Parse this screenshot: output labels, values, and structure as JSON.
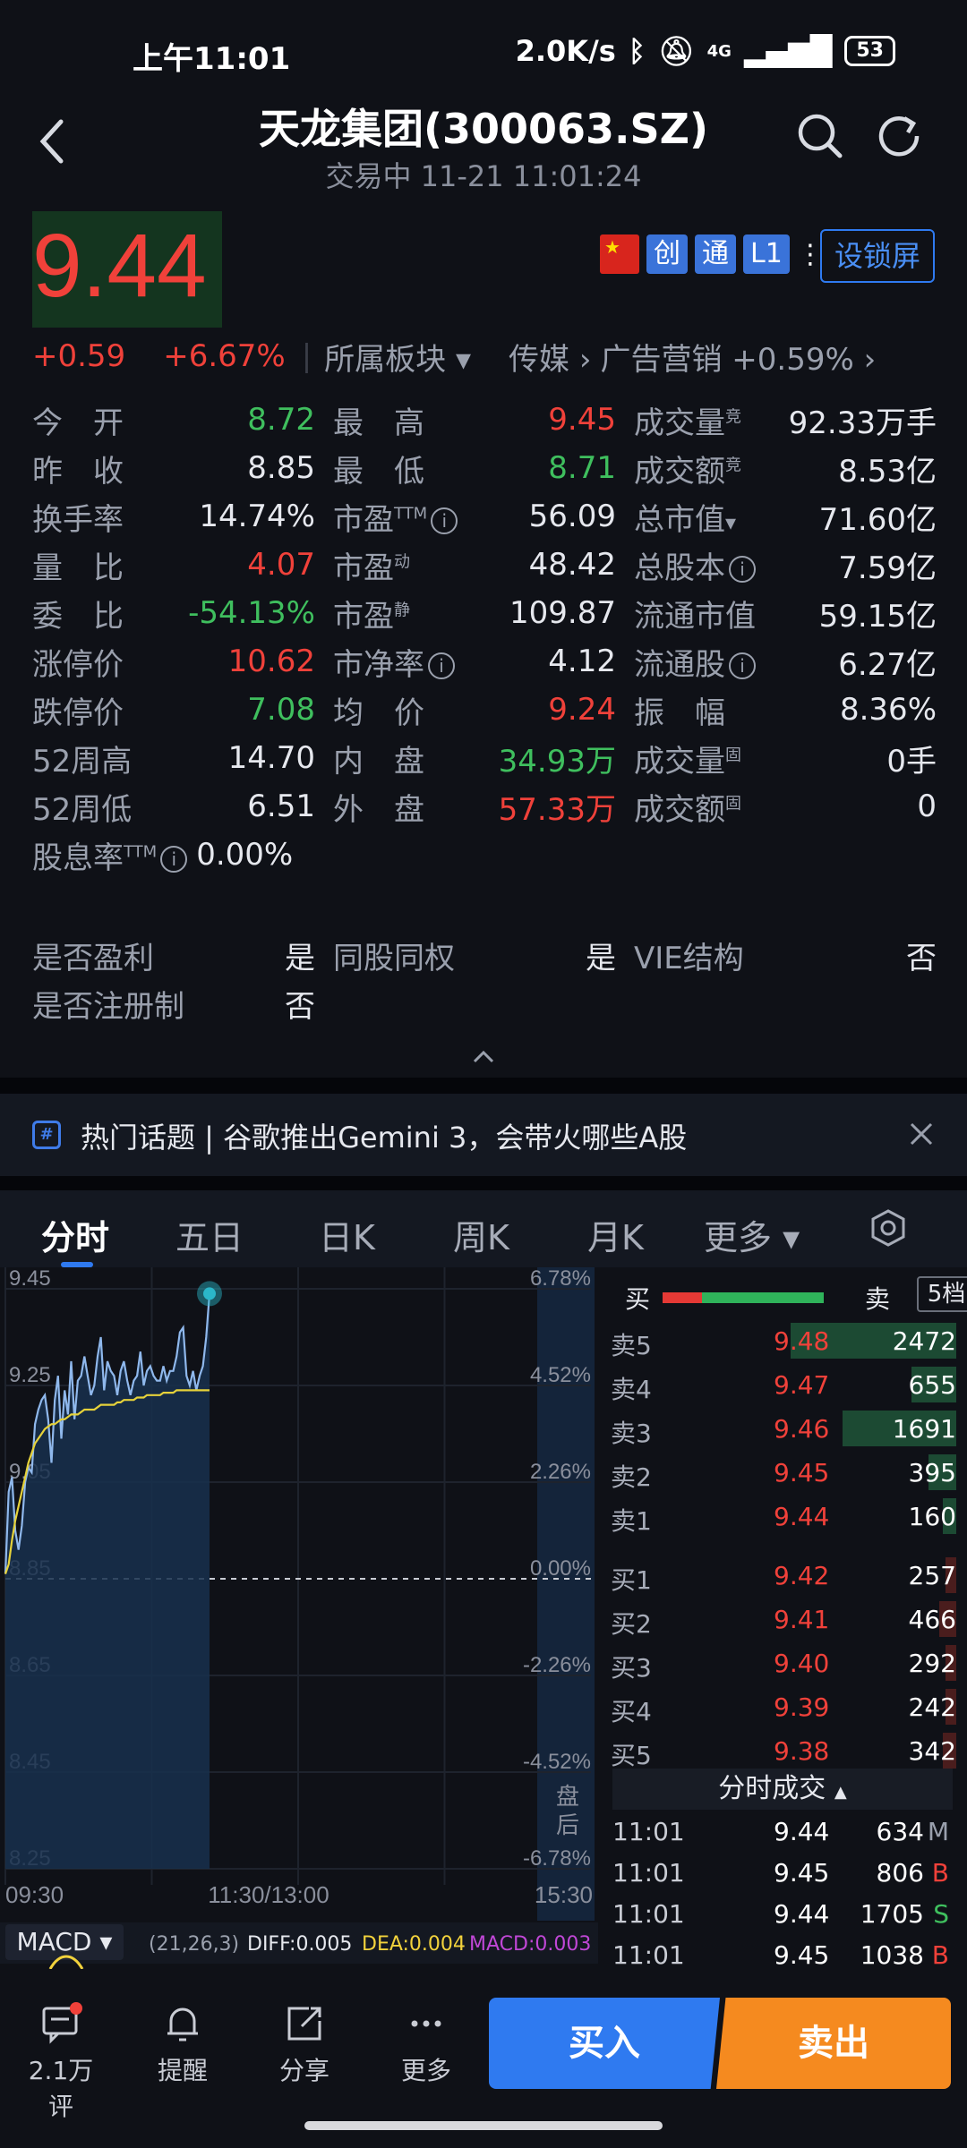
{
  "status": {
    "time": "上午11:01",
    "speed": "2.0K/s",
    "network": "4G",
    "battery": "53"
  },
  "header": {
    "title": "天龙集团(300063.SZ)",
    "subtitle": "交易中 11-21 11:01:24",
    "search_icon": "search-icon",
    "refresh_icon": "refresh-icon"
  },
  "quote": {
    "price": "9.44",
    "change": "+0.59",
    "change_pct": "+6.67%",
    "sector_label": "所属板块",
    "sector_path": "传媒",
    "sub_sector": "广告营销 +0.59%",
    "tags": [
      "创",
      "通",
      "L1"
    ],
    "lock_button": "设锁屏"
  },
  "stats": [
    [
      {
        "label": "今　开",
        "value": "8.72",
        "color": "green"
      },
      {
        "label": "最　高",
        "value": "9.45",
        "color": "red"
      },
      {
        "label": "成交量",
        "sup": "竞",
        "value": "92.33万手",
        "color": "white"
      }
    ],
    [
      {
        "label": "昨　收",
        "value": "8.85",
        "color": "white"
      },
      {
        "label": "最　低",
        "value": "8.71",
        "color": "green"
      },
      {
        "label": "成交额",
        "sup": "竞",
        "value": "8.53亿",
        "color": "white"
      }
    ],
    [
      {
        "label": "换手率",
        "value": "14.74%",
        "color": "white"
      },
      {
        "label": "市盈",
        "sup": "TTM",
        "info": true,
        "value": "56.09",
        "color": "white"
      },
      {
        "label": "总市值",
        "dropdown": true,
        "value": "71.60亿",
        "color": "white"
      }
    ],
    [
      {
        "label": "量　比",
        "value": "4.07",
        "color": "red"
      },
      {
        "label": "市盈",
        "sup": "动",
        "value": "48.42",
        "color": "white"
      },
      {
        "label": "总股本",
        "info": true,
        "value": "7.59亿",
        "color": "white"
      }
    ],
    [
      {
        "label": "委　比",
        "value": "-54.13%",
        "color": "green"
      },
      {
        "label": "市盈",
        "sup": "静",
        "value": "109.87",
        "color": "white"
      },
      {
        "label": "流通市值",
        "value": "59.15亿",
        "color": "white"
      }
    ],
    [
      {
        "label": "涨停价",
        "value": "10.62",
        "color": "red"
      },
      {
        "label": "市净率",
        "info": true,
        "value": "4.12",
        "color": "white"
      },
      {
        "label": "流通股",
        "info": true,
        "value": "6.27亿",
        "color": "white"
      }
    ],
    [
      {
        "label": "跌停价",
        "value": "7.08",
        "color": "green"
      },
      {
        "label": "均　价",
        "value": "9.24",
        "color": "red"
      },
      {
        "label": "振　幅",
        "value": "8.36%",
        "color": "white"
      }
    ],
    [
      {
        "label": "52周高",
        "value": "14.70",
        "color": "white"
      },
      {
        "label": "内　盘",
        "value": "34.93万",
        "color": "green"
      },
      {
        "label": "成交量",
        "sup": "固",
        "value": "0手",
        "color": "white"
      }
    ],
    [
      {
        "label": "52周低",
        "value": "6.51",
        "color": "white"
      },
      {
        "label": "外　盘",
        "value": "57.33万",
        "color": "red"
      },
      {
        "label": "成交额",
        "sup": "固",
        "value": "0",
        "color": "white"
      }
    ],
    [
      {
        "label": "股息率",
        "sup": "TTM",
        "info": true,
        "value": "0.00%",
        "color": "white"
      }
    ]
  ],
  "flags": [
    [
      {
        "label": "是否盈利",
        "value": "是"
      },
      {
        "label": "同股同权",
        "value": "是"
      },
      {
        "label": "VIE结构",
        "value": "否"
      }
    ],
    [
      {
        "label": "是否注册制",
        "value": "否"
      }
    ]
  ],
  "topic": {
    "text": "热门话题 | 谷歌推出Gemini 3，会带火哪些A股"
  },
  "chart_tabs": [
    "分时",
    "五日",
    "日K",
    "周K",
    "月K",
    "更多"
  ],
  "chart_data": {
    "type": "line",
    "y_left_ticks": [
      "9.45",
      "9.25",
      "9.05",
      "8.85",
      "8.65",
      "8.45",
      "8.25"
    ],
    "y_right_ticks": [
      "6.78%",
      "4.52%",
      "2.26%",
      "0.00%",
      "-2.26%",
      "-4.52%",
      "-6.78%"
    ],
    "x_ticks": [
      "09:30",
      "11:30/13:00",
      "15:30"
    ],
    "ylim": [
      8.25,
      9.45
    ],
    "prev_close": 8.85,
    "after_hours_label": [
      "盘",
      "后"
    ],
    "series": [
      {
        "color": "#8fb8ec",
        "values": [
          8.86,
          9.03,
          9.06,
          8.95,
          8.91,
          8.96,
          9.05,
          9.08,
          9.07,
          9.17,
          9.2,
          9.22,
          9.23,
          9.18,
          9.09,
          9.22,
          9.27,
          9.14,
          9.24,
          9.19,
          9.3,
          9.18,
          9.26,
          9.27,
          9.31,
          9.27,
          9.23,
          9.25,
          9.31,
          9.35,
          9.24,
          9.3,
          9.28,
          9.27,
          9.23,
          9.28,
          9.3,
          9.26,
          9.23,
          9.26,
          9.27,
          9.32,
          9.25,
          9.28,
          9.29,
          9.27,
          9.26,
          9.26,
          9.29,
          9.26,
          9.28,
          9.28,
          9.31,
          9.36,
          9.37,
          9.27,
          9.25,
          9.28,
          9.24,
          9.27,
          9.29,
          9.35,
          9.44
        ]
      },
      {
        "color": "#e6d23a",
        "values": [
          8.86,
          8.88,
          8.93,
          8.97,
          9.0,
          9.03,
          9.06,
          9.09,
          9.11,
          9.13,
          9.14,
          9.15,
          9.16,
          9.165,
          9.17,
          9.17,
          9.175,
          9.18,
          9.18,
          9.185,
          9.19,
          9.19,
          9.19,
          9.195,
          9.2,
          9.2,
          9.2,
          9.2,
          9.205,
          9.21,
          9.21,
          9.21,
          9.21,
          9.21,
          9.215,
          9.215,
          9.22,
          9.22,
          9.22,
          9.22,
          9.225,
          9.225,
          9.225,
          9.23,
          9.23,
          9.23,
          9.23,
          9.23,
          9.235,
          9.235,
          9.235,
          9.235,
          9.24,
          9.24,
          9.24,
          9.24,
          9.24,
          9.24,
          9.24,
          9.24,
          9.24,
          9.24,
          9.24
        ]
      }
    ]
  },
  "orderbook": {
    "buy_label": "买",
    "sell_label": "卖",
    "depth_button": "5档",
    "asks": [
      {
        "label": "卖5",
        "price": "9.48",
        "vol": "2472",
        "bar": 0.48
      },
      {
        "label": "卖4",
        "price": "9.47",
        "vol": "655",
        "bar": 0.13
      },
      {
        "label": "卖3",
        "price": "9.46",
        "vol": "1691",
        "bar": 0.33
      },
      {
        "label": "卖2",
        "price": "9.45",
        "vol": "395",
        "bar": 0.08
      },
      {
        "label": "卖1",
        "price": "9.44",
        "vol": "160",
        "bar": 0.04
      }
    ],
    "bids": [
      {
        "label": "买1",
        "price": "9.42",
        "vol": "257",
        "bar": 0.03
      },
      {
        "label": "买2",
        "price": "9.41",
        "vol": "466",
        "bar": 0.05
      },
      {
        "label": "买3",
        "price": "9.40",
        "vol": "292",
        "bar": 0.03
      },
      {
        "label": "买4",
        "price": "9.39",
        "vol": "242",
        "bar": 0.03
      },
      {
        "label": "买5",
        "price": "9.38",
        "vol": "342",
        "bar": 0.04
      }
    ],
    "trades_header": "分时成交",
    "trades": [
      {
        "time": "11:01",
        "price": "9.44",
        "vol": "634",
        "flag": "M",
        "flag_color": "#9aa0ad"
      },
      {
        "time": "11:01",
        "price": "9.45",
        "vol": "806",
        "flag": "B",
        "flag_color": "#f0413a"
      },
      {
        "time": "11:01",
        "price": "9.44",
        "vol": "1705",
        "flag": "S",
        "flag_color": "#3fbf5e"
      },
      {
        "time": "11:01",
        "price": "9.45",
        "vol": "1038",
        "flag": "B",
        "flag_color": "#f0413a"
      }
    ]
  },
  "macd": {
    "label": "MACD",
    "params": "(21,26,3)",
    "diff": "DIFF:0.005",
    "dea": "DEA:0.004",
    "macd": "MACD:0.003"
  },
  "bottom": {
    "comments": "2.1万评",
    "remind": "提醒",
    "share": "分享",
    "more": "更多",
    "buy": "买入",
    "sell": "卖出"
  },
  "colors": {
    "up": "#f0413a",
    "down": "#3fbf5e",
    "accent": "#2f7af0",
    "sell_btn": "#f58a1f"
  }
}
